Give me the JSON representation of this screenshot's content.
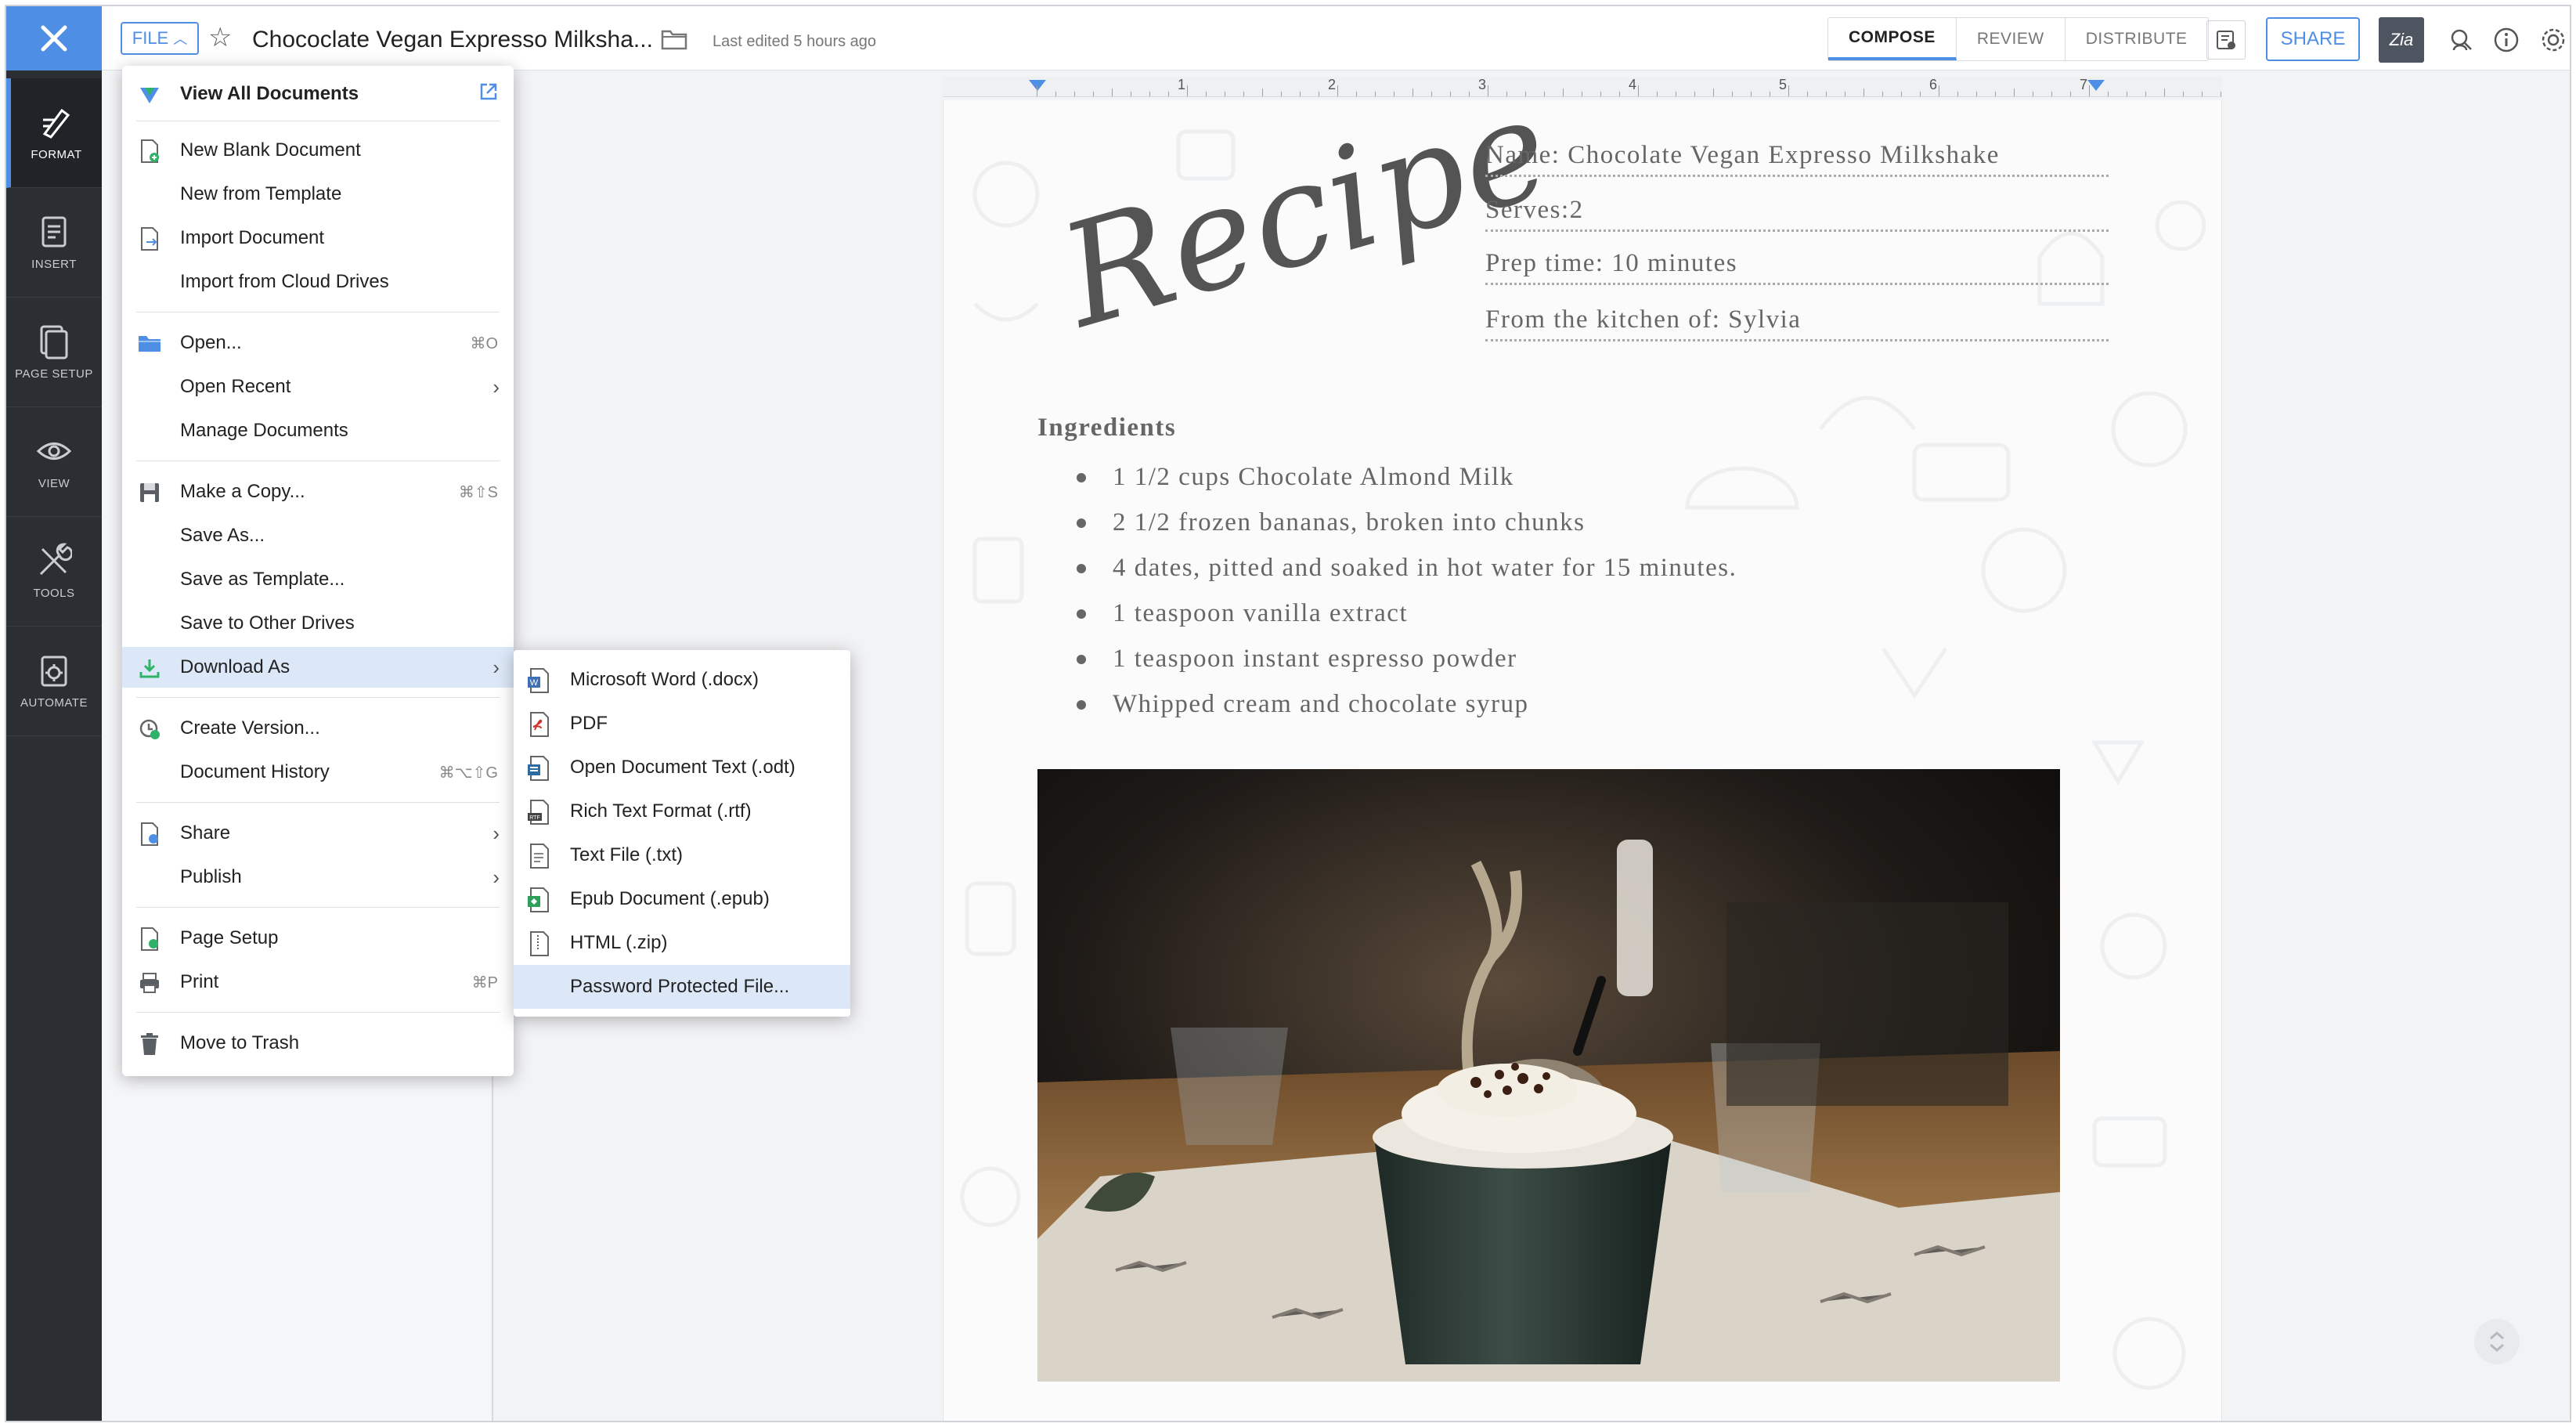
{
  "rail": {
    "items": [
      {
        "label": "FORMAT",
        "icon": "format-icon"
      },
      {
        "label": "INSERT",
        "icon": "insert-icon"
      },
      {
        "label": "PAGE SETUP",
        "icon": "page-setup-icon"
      },
      {
        "label": "VIEW",
        "icon": "eye-icon"
      },
      {
        "label": "TOOLS",
        "icon": "tools-icon"
      },
      {
        "label": "AUTOMATE",
        "icon": "automate-icon"
      }
    ],
    "active": "FORMAT"
  },
  "header": {
    "file_label": "FILE",
    "title": "Chococlate Vegan Expresso Milksha...",
    "last_edited": "Last edited 5 hours ago",
    "tabs": [
      "COMPOSE",
      "REVIEW",
      "DISTRIBUTE"
    ],
    "active_tab": "COMPOSE",
    "share_label": "SHARE",
    "zia_label": "Zia"
  },
  "ruler": {
    "numbers": [
      "1",
      "2",
      "3",
      "4",
      "5",
      "6",
      "7"
    ]
  },
  "document": {
    "recipe_heading": "Recipe",
    "name_line": "Name: Chocolate Vegan Expresso Milkshake",
    "serves_line": "Serves:2",
    "prep_line": "Prep time: 10 minutes",
    "kitchen_line": "From the kitchen of: Sylvia",
    "ingredients_heading": "Ingredients",
    "ingredients": [
      "1 1/2 cups Chocolate Almond Milk",
      "2 1/2 frozen bananas, broken into chunks",
      "4 dates, pitted and soaked in hot water for 15 minutes.",
      "1 teaspoon vanilla extract",
      "1 teaspoon instant espresso powder",
      "Whipped cream and chocolate syrup"
    ]
  },
  "file_menu": {
    "view_all": "View All Documents",
    "new_blank": "New Blank Document",
    "new_template": "New from Template",
    "import_doc": "Import Document",
    "import_cloud": "Import from Cloud Drives",
    "open": "Open...",
    "open_shortcut": "⌘O",
    "open_recent": "Open Recent",
    "manage_docs": "Manage Documents",
    "make_copy": "Make a Copy...",
    "make_copy_shortcut": "⌘⇧S",
    "save_as": "Save As...",
    "save_template": "Save as Template...",
    "save_other": "Save to Other Drives",
    "download_as": "Download As",
    "create_version": "Create Version...",
    "doc_history": "Document History",
    "doc_history_shortcut": "⌘⌥⇧G",
    "share": "Share",
    "publish": "Publish",
    "page_setup": "Page Setup",
    "print": "Print",
    "print_shortcut": "⌘P",
    "trash": "Move to Trash",
    "highlighted": "Download As"
  },
  "download_menu": {
    "items": [
      "Microsoft Word (.docx)",
      "PDF",
      "Open Document Text (.odt)",
      "Rich Text Format (.rtf)",
      "Text File (.txt)",
      "Epub Document (.epub)",
      "HTML (.zip)",
      "Password Protected File..."
    ],
    "highlighted": "Password Protected File..."
  },
  "colors": {
    "accent": "#4e8ee5",
    "rail": "#2b2e33",
    "menu_highlight": "#dce8f8",
    "doc_text": "#666666"
  }
}
